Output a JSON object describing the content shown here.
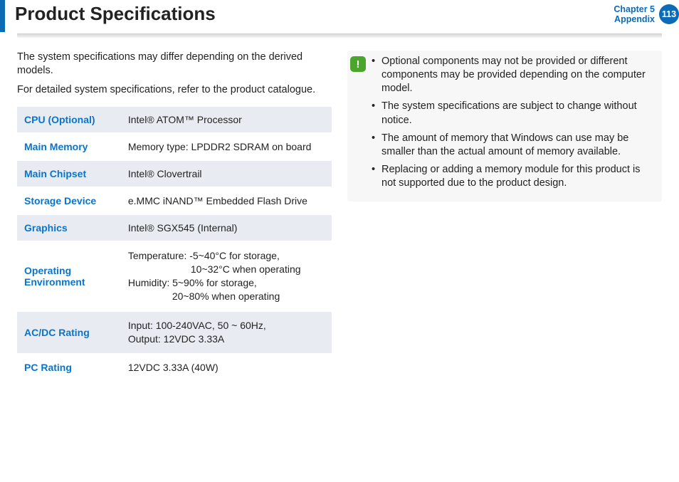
{
  "header": {
    "title": "Product Specifications",
    "chapter_line1": "Chapter 5",
    "chapter_line2": "Appendix",
    "page_number": "113"
  },
  "left": {
    "intro1": "The system specifications may differ depending on the derived models.",
    "intro2": "For detailed system specifications, refer to the product catalogue.",
    "specs": {
      "cpu_key": "CPU (Optional)",
      "cpu_val": "Intel® ATOM™ Processor",
      "mem_key": "Main Memory",
      "mem_val": "Memory type: LPDDR2 SDRAM on board",
      "chip_key": "Main Chipset",
      "chip_val": "Intel® Clovertrail",
      "stor_key": "Storage Device",
      "stor_val": "e.MMC iNAND™ Embedded Flash Drive",
      "gfx_key": "Graphics",
      "gfx_val": "Intel® SGX545 (Internal)",
      "env_key": "Operating Environment",
      "env_l1": "Temperature: -5~40°C for storage,",
      "env_l2": "10~32°C when operating",
      "env_l3": "Humidity: 5~90% for storage,",
      "env_l4": "20~80% when operating",
      "ac_key": "AC/DC Rating",
      "ac_l1": "Input: 100-240VAC, 50 ~ 60Hz,",
      "ac_l2": "Output: 12VDC 3.33A",
      "pc_key": "PC Rating",
      "pc_val": "12VDC 3.33A (40W)"
    }
  },
  "right": {
    "icon": "!",
    "notes": {
      "n1": "Optional components may not be provided or different components may be provided depending on the computer model.",
      "n2": "The system specifications are subject to change without notice.",
      "n3": "The amount of memory that Windows can use may be smaller than the actual amount of memory available.",
      "n4": "Replacing or adding a memory module for this product is not supported due to the product design."
    }
  }
}
